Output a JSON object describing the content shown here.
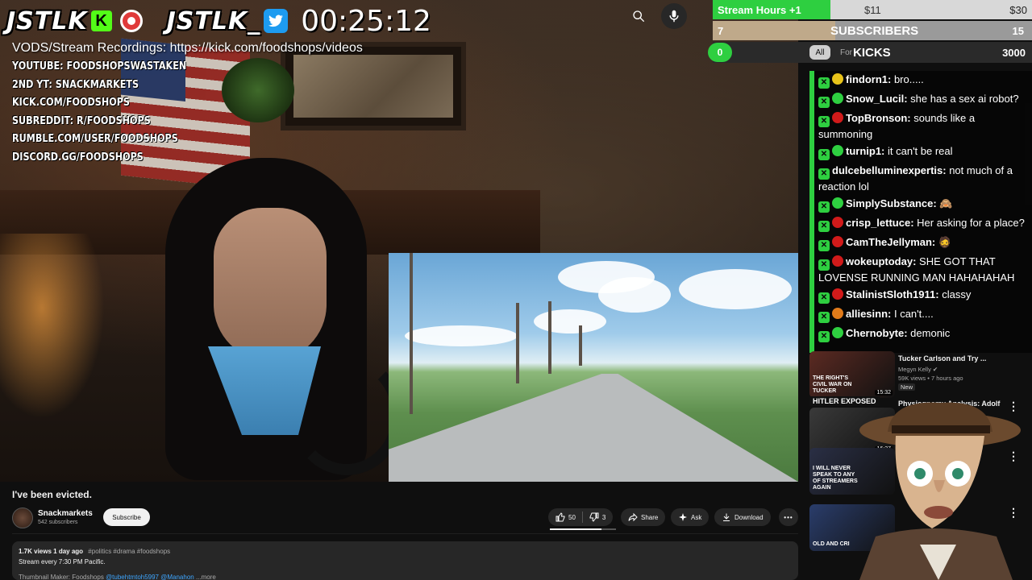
{
  "overlay": {
    "logo_left": "JSTLK",
    "logo_left_badge": "K",
    "logo_right": "JSTLK_",
    "timer": "00:25:12",
    "vods_line": "VODS/Stream Recordings: https://kick.com/foodshops/videos",
    "socials": [
      "YOUTUBE: FOODSHOPSWASTAKEN",
      "2ND YT: SNACKMARKETS",
      "KICK.COM/FOODSHOPS",
      "SUBREDDIT: R/FOODSHOPS",
      "RUMBLE.COM/USER/FOODSHOPS",
      "DISCORD.GG/FOODSHOPS"
    ]
  },
  "goals": {
    "stream_hours": {
      "label": "Stream Hours +1",
      "mid": "$11",
      "end": "$30"
    },
    "subscribers": {
      "start": "7",
      "label": "SUBSCRIBERS",
      "end": "15"
    },
    "kicks": {
      "start": "0",
      "label": "KICKS",
      "end": "3000"
    }
  },
  "chips": {
    "all": "All",
    "for_you": "For"
  },
  "chat": [
    {
      "name": "findorn1:",
      "text": " bro.....",
      "dot": "#e8c31a"
    },
    {
      "name": "Snow_Lucil:",
      "text": " she has a sex ai robot?",
      "dot": "#2ecf40"
    },
    {
      "name": "TopBronson:",
      "text": " sounds like a summoning",
      "dot": "#d11a1a"
    },
    {
      "name": "turnip1:",
      "text": " it can't be real",
      "dot": "#2ecf40"
    },
    {
      "name": "dulcebelluminexpertis:",
      "text": " not much of a reaction lol",
      "dot": ""
    },
    {
      "name": "SimplySubstance:",
      "text": " 🙈",
      "dot": "#2ecf40"
    },
    {
      "name": "crisp_lettuce:",
      "text": " Her asking for a place?",
      "dot": "#d11a1a"
    },
    {
      "name": "CamTheJellyman:",
      "text": " 🧔",
      "dot": "#d11a1a"
    },
    {
      "name": "wokeuptoday:",
      "text": " SHE GOT THAT LOVENSE RUNNING MAN HAHAHAHAH",
      "dot": "#d11a1a"
    },
    {
      "name": "StalinistSloth1911:",
      "text": " classy",
      "dot": "#d11a1a"
    },
    {
      "name": "alliesinn:",
      "text": " I can't....",
      "dot": "#e07a1a"
    },
    {
      "name": "Chernobyte:",
      "text": " demonic",
      "dot": "#2ecf40"
    }
  ],
  "recommended": [
    {
      "title": "Tucker Carlson and Try ...",
      "channel": "Megyn Kelly ✔",
      "meta": "59K views • 7 hours ago",
      "badge": "New",
      "duration": "15:32",
      "thumb_text": "THE RIGHT'S CIVIL WAR ON TUCKER"
    },
    {
      "title": "Physiognomy Analysis: Adolf",
      "channel": "",
      "meta": "",
      "badge": "",
      "duration": "16:37",
      "thumb_text": "HITLER EXPOSED"
    },
    {
      "title": "",
      "channel": "",
      "meta": "",
      "badge": "",
      "duration": "",
      "thumb_text": "I WILL NEVER SPEAK TO ANY OF STREAMERS AGAIN"
    },
    {
      "title": "",
      "channel": "",
      "meta": "",
      "badge": "",
      "duration": "",
      "thumb_text": "OLD AND CRI"
    }
  ],
  "video": {
    "title": "I've been evicted.",
    "channel": "Snackmarkets",
    "subscribers": "542 subscribers",
    "subscribe_label": "Subscribe",
    "likes": "50",
    "dislikes": "3",
    "share": "Share",
    "ask": "Ask",
    "download": "Download",
    "views": "1.7K views",
    "age": "1 day ago",
    "tags": "#politics #drama #foodshops",
    "schedule": "Stream every 7:30 PM Pacific.",
    "thumbnail_line": "Thumbnail Maker: Foodshops",
    "thumbnail_links": "@tubehtmtoh5997 @Manahon",
    "more": "...more"
  },
  "colors": {
    "accent_green": "#2ecf40",
    "youtube_bg": "#0f0f0f",
    "pill_bg": "#272727"
  }
}
